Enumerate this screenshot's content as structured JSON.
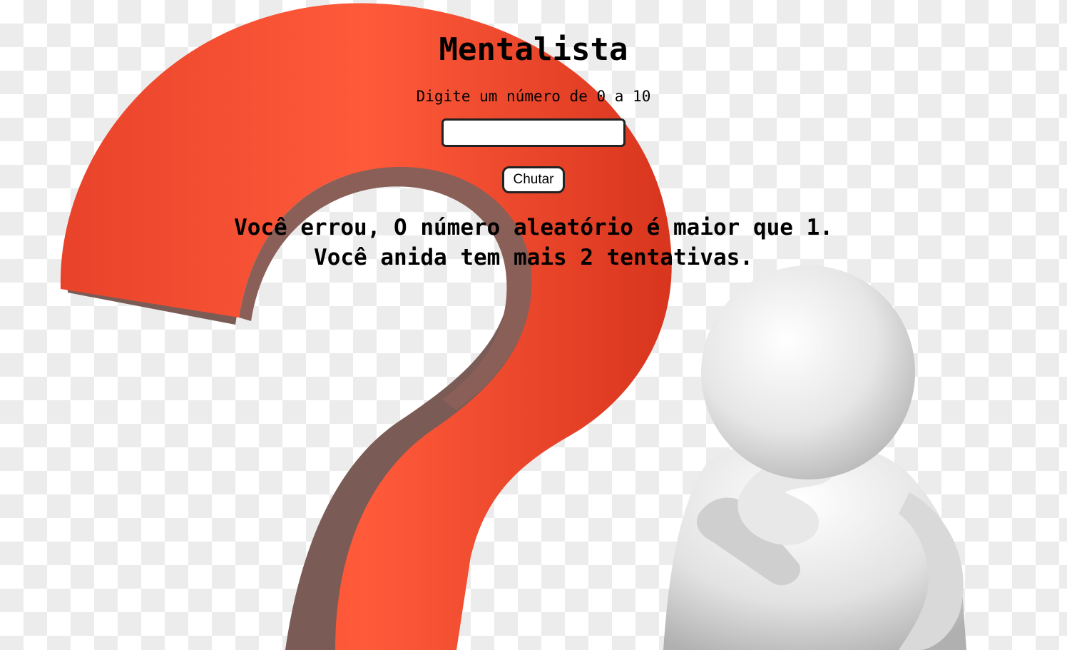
{
  "page": {
    "title": "Mentalista",
    "instructions": "Digite um número de 0 a 10"
  },
  "form": {
    "guess_value": "",
    "guess_button_label": "Chutar"
  },
  "result": {
    "line1": "Você errou, O número aleatório é maior que 1.",
    "line2": "Você anida tem mais 2 tentativas."
  },
  "colors": {
    "question_mark": "#f04a2a",
    "question_mark_shadow": "#7a5b55",
    "figure": "#ededed"
  },
  "background": {
    "illustration": "question-mark-thinking-figure"
  }
}
